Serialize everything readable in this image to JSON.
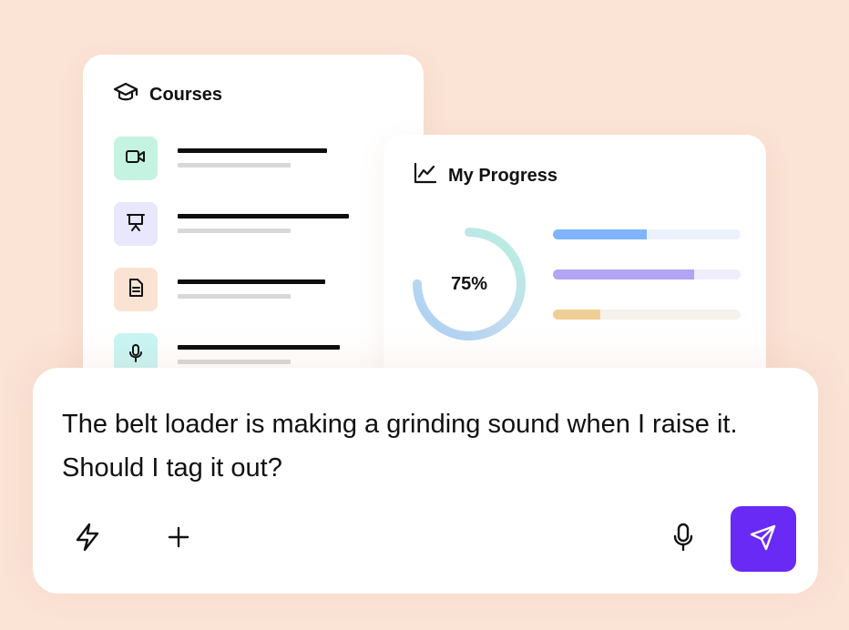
{
  "courses": {
    "title": "Courses",
    "items": [
      {
        "icon": "video-camera-icon",
        "bg": "#c5f3e2"
      },
      {
        "icon": "presentation-icon",
        "bg": "#e8e7fd"
      },
      {
        "icon": "document-icon",
        "bg": "#fbe3d3"
      },
      {
        "icon": "microphone-icon",
        "bg": "#c9f5f3"
      }
    ]
  },
  "progress": {
    "title": "My Progress",
    "percent_label": "75%",
    "percent_value": 0.75,
    "bars": [
      {
        "fill": 0.5,
        "color": "#7fb4f8",
        "track": "#ebf1fd"
      },
      {
        "fill": 0.75,
        "color": "#b3a4f4",
        "track": "#f0edfd"
      },
      {
        "fill": 0.25,
        "color": "#f0cf96",
        "track": "#f7f1ec"
      }
    ]
  },
  "chat": {
    "message": "The belt loader is making a grinding sound when I raise it. Should I tag it out?",
    "accent": "#6a2af5"
  }
}
